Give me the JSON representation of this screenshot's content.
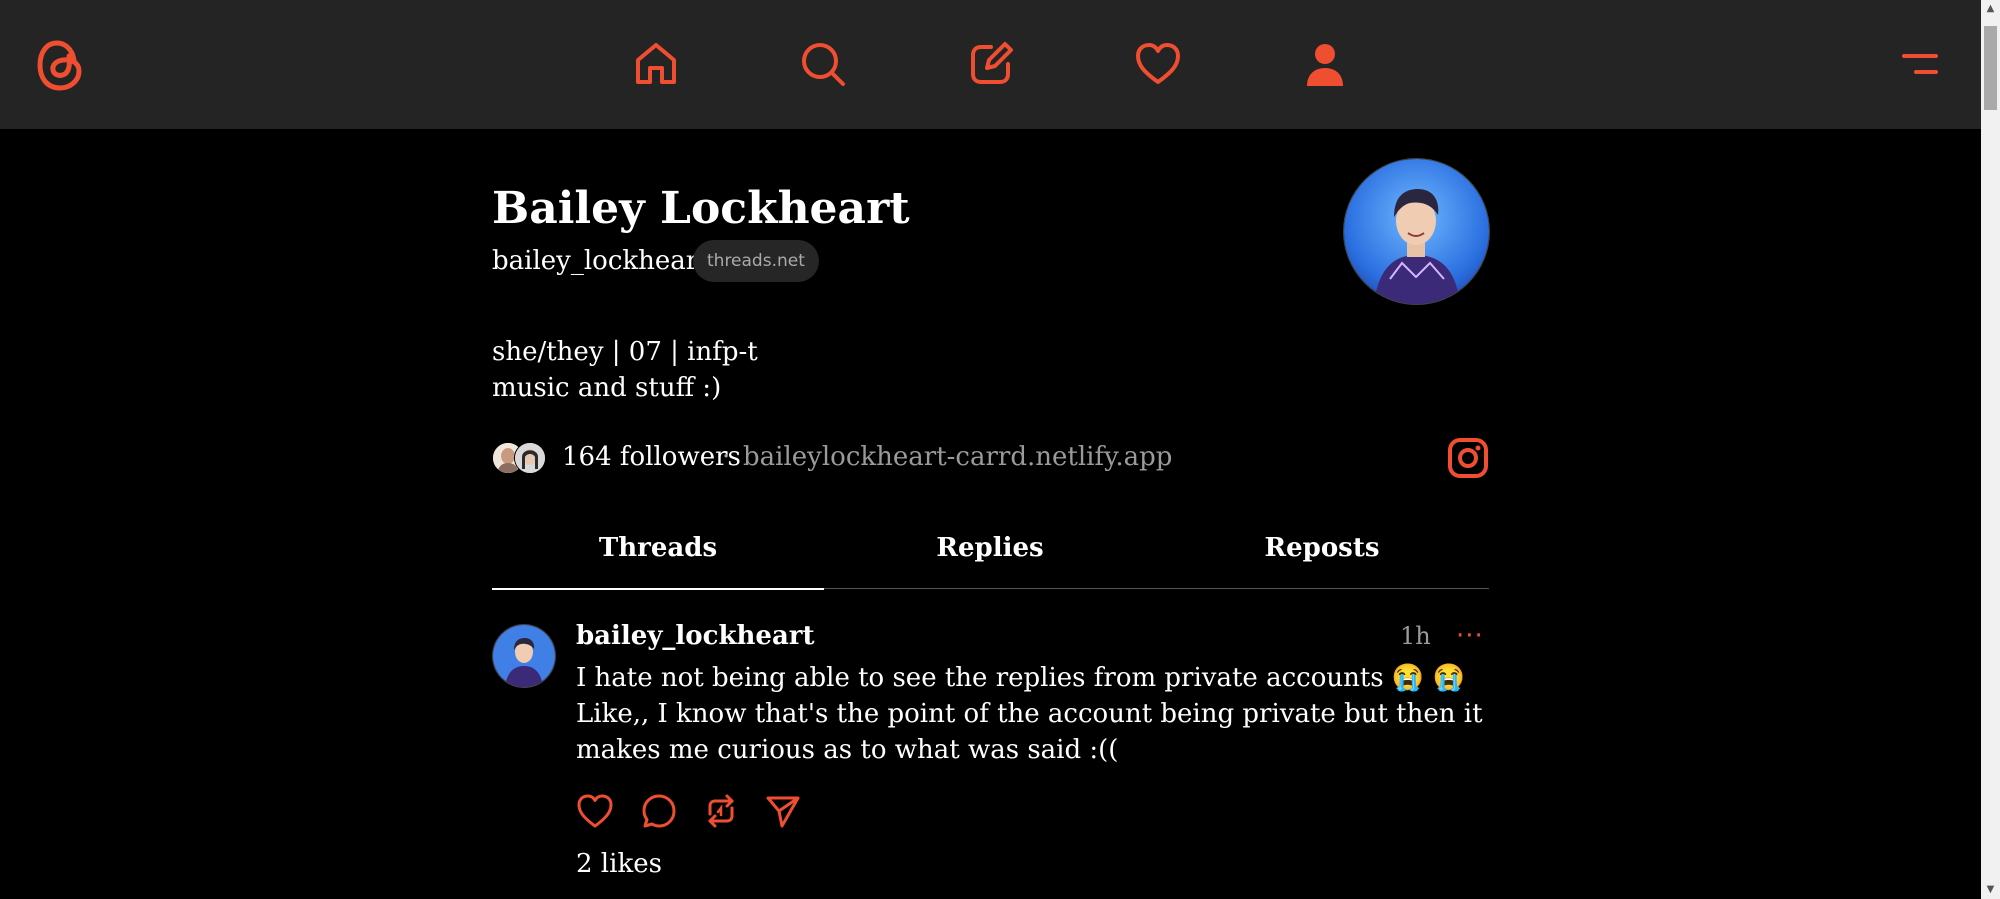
{
  "theme": {
    "accent": "#f04e30",
    "topbar_bg": "#242424",
    "background": "#000000"
  },
  "nav": {
    "logo_icon": "threads-logo-icon",
    "items": [
      {
        "icon": "home-icon"
      },
      {
        "icon": "search-icon"
      },
      {
        "icon": "compose-icon"
      },
      {
        "icon": "heart-icon"
      },
      {
        "icon": "profile-icon"
      }
    ],
    "menu_icon": "menu-icon"
  },
  "profile": {
    "display_name": "Bailey Lockheart",
    "username": "bailey_lockheart",
    "domain_badge": "threads.net",
    "bio_lines": [
      "she/they | 07 | infp-t",
      "music and stuff :)"
    ],
    "followers": "164 followers",
    "separator": "·",
    "link": "baileylockheart-carrd.netlify.app",
    "instagram_icon": "instagram-icon"
  },
  "tabs": [
    {
      "label": "Threads",
      "active": true
    },
    {
      "label": "Replies",
      "active": false
    },
    {
      "label": "Reposts",
      "active": false
    }
  ],
  "post": {
    "username": "bailey_lockheart",
    "time": "1h",
    "more": "···",
    "text": "I hate not being able to see the replies from private accounts 😭 😭 Like,, I know that's the point of the account being private but then it makes me curious as to what was said :((",
    "likes": "2 likes",
    "actions": [
      "like-icon",
      "reply-icon",
      "repost-icon",
      "share-icon"
    ]
  }
}
